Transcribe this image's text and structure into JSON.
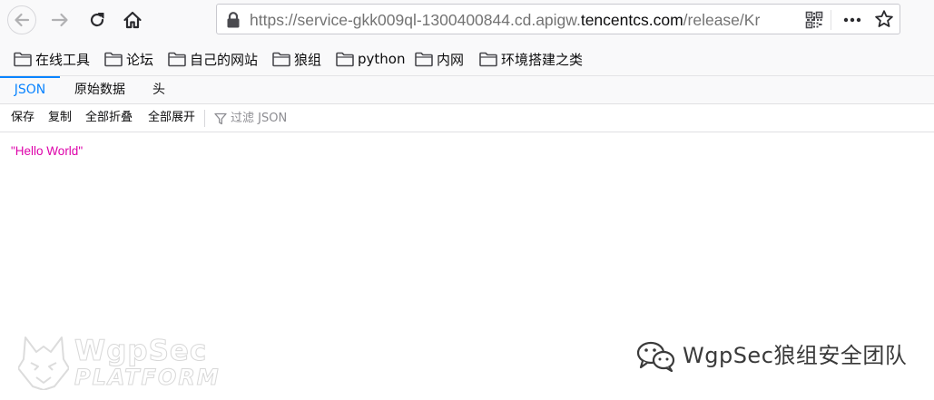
{
  "browser": {
    "url_prefix": "https://service-gkk009ql-1300400844.cd.apigw.",
    "url_host": "tencentcs.com",
    "url_suffix": "/release/Kr"
  },
  "bookmarks": [
    {
      "label": "在线工具"
    },
    {
      "label": "论坛"
    },
    {
      "label": "自己的网站"
    },
    {
      "label": "狼组"
    },
    {
      "label": "python"
    },
    {
      "label": "内网"
    },
    {
      "label": "环境搭建之类"
    }
  ],
  "viewer": {
    "tabs": [
      {
        "label": "JSON",
        "active": true
      },
      {
        "label": "原始数据",
        "active": false
      },
      {
        "label": "头",
        "active": false
      }
    ],
    "toolbar": {
      "save": "保存",
      "copy": "复制",
      "collapse_all": "全部折叠",
      "expand_all": "全部展开",
      "filter_placeholder": "过滤 JSON"
    },
    "content": "\"Hello World\""
  },
  "watermarks": {
    "left_title": "WgpSec",
    "left_subtitle": "PLATFORM",
    "right_text": "WgpSec狼组安全团队"
  },
  "colors": {
    "accent": "#0a84ff",
    "json_string": "#dd00a9",
    "toolbar_bg": "#f9f9fa"
  }
}
